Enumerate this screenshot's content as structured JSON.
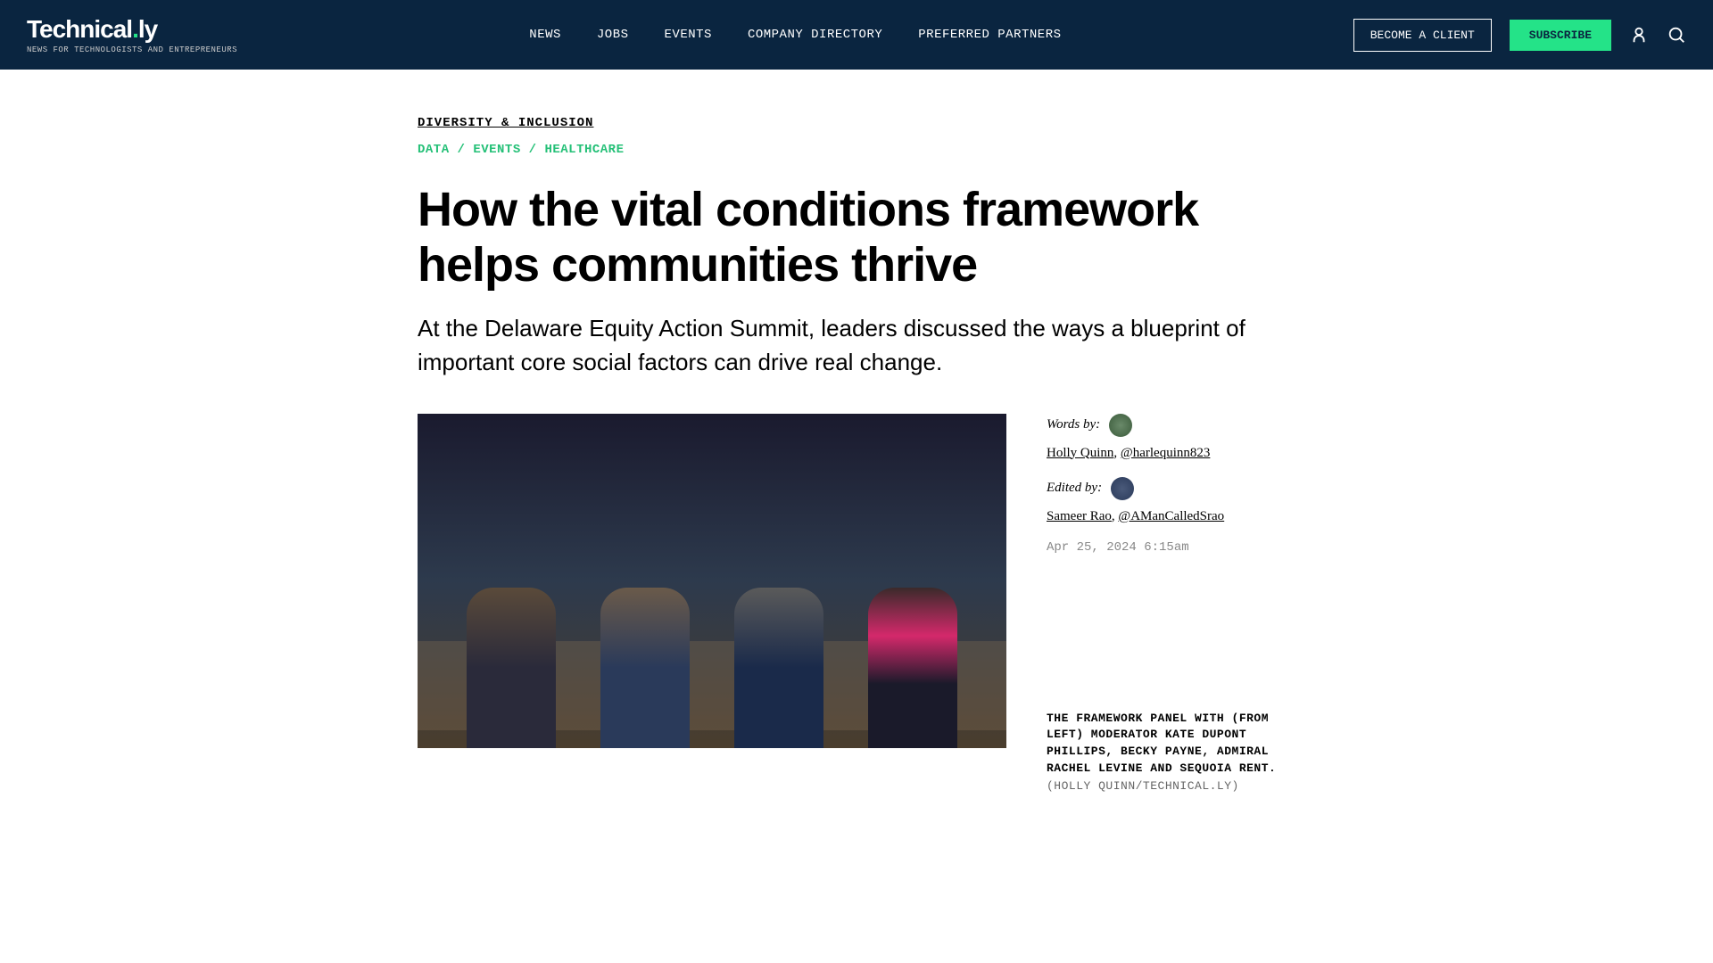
{
  "header": {
    "logo": "Technical.ly",
    "tagline": "NEWS FOR TECHNOLOGISTS AND ENTREPRENEURS",
    "nav": [
      "NEWS",
      "JOBS",
      "EVENTS",
      "COMPANY DIRECTORY",
      "PREFERRED PARTNERS"
    ],
    "cta_outline": "BECOME A CLIENT",
    "cta_primary": "SUBSCRIBE"
  },
  "article": {
    "category": "DIVERSITY & INCLUSION",
    "tags": [
      "DATA",
      "EVENTS",
      "HEALTHCARE"
    ],
    "headline": "How the vital conditions framework helps communities thrive",
    "subhead": "At the Delaware Equity Action Summit, leaders discussed the ways a blueprint of important core social factors can drive real change.",
    "words_by_label": "Words by:",
    "author_name": "Holly Quinn",
    "author_handle": "@harlequinn823",
    "edited_by_label": "Edited by:",
    "editor_name": "Sameer Rao",
    "editor_handle": "@AManCalledSrao",
    "timestamp": "Apr 25, 2024 6:15am",
    "caption": "THE FRAMEWORK PANEL WITH (FROM LEFT) MODERATOR KATE DUPONT PHILLIPS, BECKY PAYNE, ADMIRAL RACHEL LEVINE AND SEQUOIA RENT.",
    "caption_credit": "(HOLLY QUINN/TECHNICAL.LY)"
  }
}
